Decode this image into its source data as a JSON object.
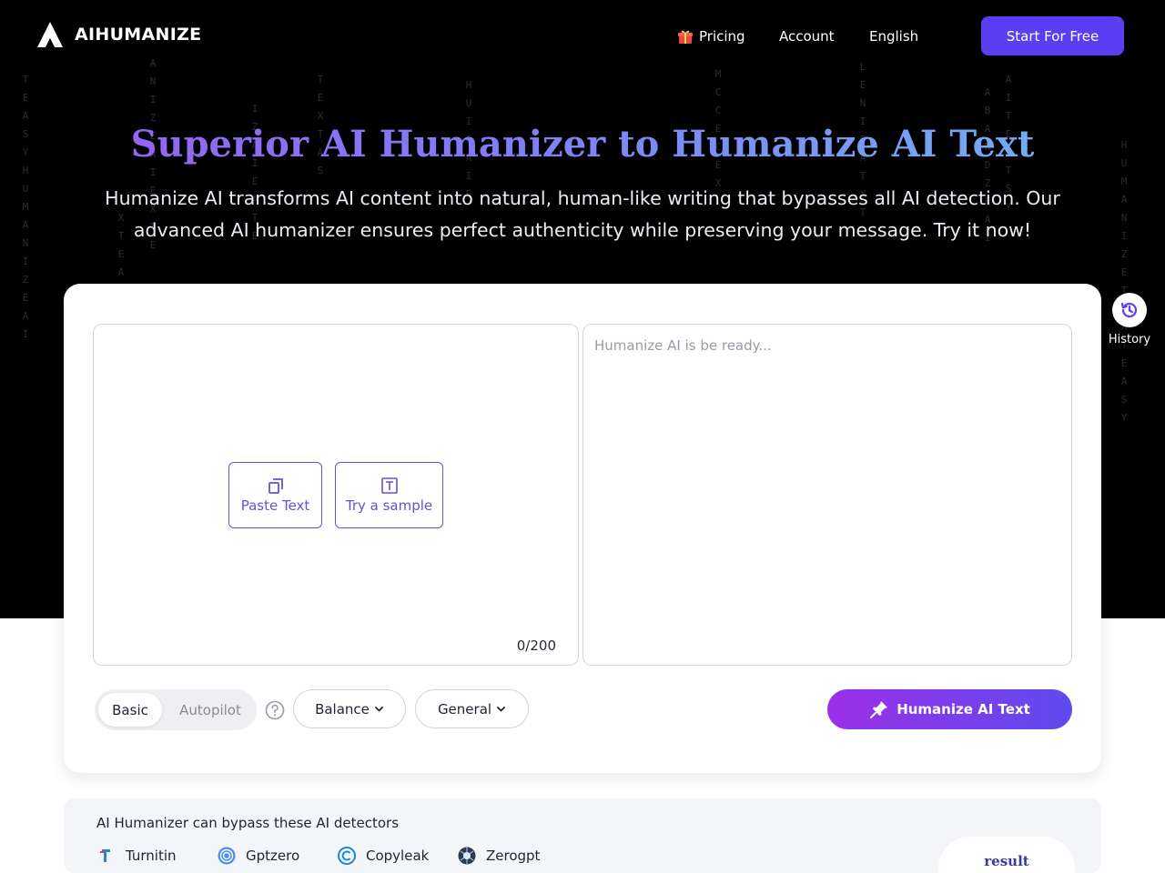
{
  "header": {
    "brand": "AIHUMANIZE",
    "nav": {
      "pricing": "Pricing",
      "account": "Account",
      "language": "English"
    },
    "cta": "Start For Free"
  },
  "hero": {
    "title": "Superior AI Humanizer to Humanize AI Text",
    "subtitle": "Humanize AI transforms AI content into natural, human-like writing that bypasses all AI detection. Our advanced AI humanizer ensures perfect authenticity while preserving your message. Try it now!"
  },
  "history": {
    "label": "History"
  },
  "editor": {
    "paste_label": "Paste Text",
    "sample_label": "Try a sample",
    "counter": "0/200",
    "output_placeholder": "Humanize AI is be ready..."
  },
  "controls": {
    "modes": [
      "Basic",
      "Autopilot"
    ],
    "active_mode": "Basic",
    "strength": "Balance",
    "purpose": "General",
    "submit_label": "Humanize AI Text"
  },
  "detectors": {
    "title": "AI Humanizer can bypass these AI detectors",
    "items": [
      {
        "name": "Turnitin",
        "icon": "turnitin-logo-icon"
      },
      {
        "name": "Gptzero",
        "icon": "gptzero-logo-icon"
      },
      {
        "name": "Copyleak",
        "icon": "copyleak-logo-icon"
      },
      {
        "name": "Zerogpt",
        "icon": "zerogpt-logo-icon"
      }
    ],
    "result_label": "result"
  },
  "colors": {
    "accent": "#5b3df2",
    "title_gradient": [
      "#9b5cf0",
      "#6fb7f2"
    ],
    "submit_gradient": [
      "#9c2fe8",
      "#5e4bef"
    ],
    "hero_background": "#000000"
  },
  "background_columns": [
    "TEASYHUMANIZEAI",
    "ANIZEAIEXTE",
    "IZAIEATE",
    "TEXTAS",
    "HUICAIE",
    "MCCECEX",
    "LENIEATXT",
    "ABANDZEAI",
    "AITEXTSY",
    "HUMANIZETEXTEASY",
    "XTEA"
  ]
}
